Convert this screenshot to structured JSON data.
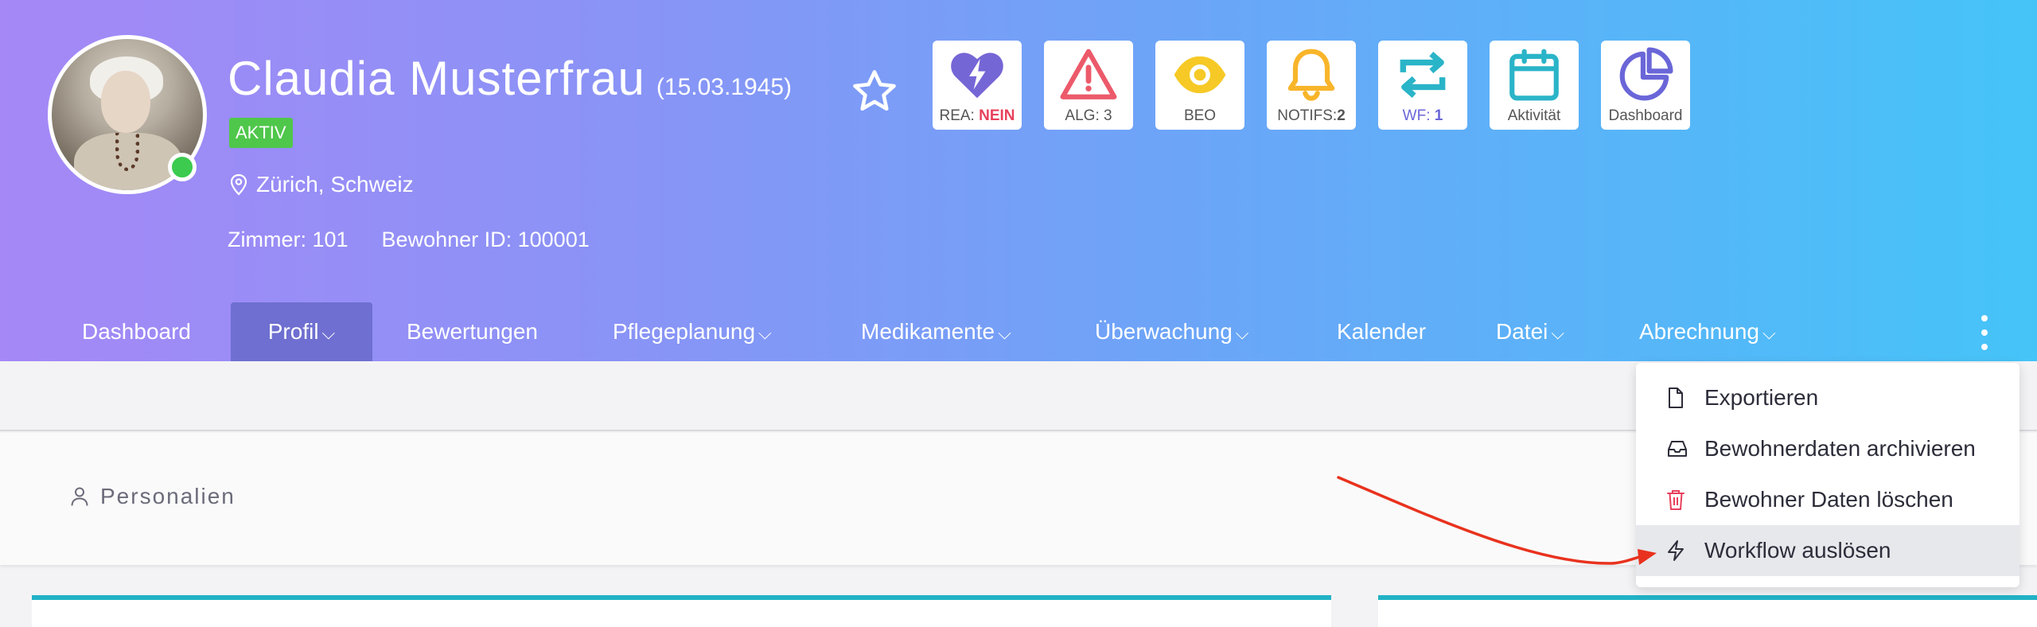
{
  "patient": {
    "name": "Claudia Musterfrau",
    "dob": "(15.03.1945)",
    "status": "AKTIV",
    "location": "Zürich, Schweiz",
    "room": "Zimmer: 101",
    "resident_id": "Bewohner ID: 100001"
  },
  "tiles": [
    {
      "icon": "heart-bolt-icon",
      "label_prefix": "REA: ",
      "label_value": "NEIN",
      "value_color": "#e8405c",
      "color": "#7566d6"
    },
    {
      "icon": "warning-triangle-icon",
      "label": "ALG: 3",
      "color": "#ec5a6a"
    },
    {
      "icon": "eye-icon",
      "label": "BEO",
      "color": "#f6c926"
    },
    {
      "icon": "bell-icon",
      "label_prefix": "NOTIFS:",
      "label_value": "2",
      "color": "#f8b52a"
    },
    {
      "icon": "repeat-icon",
      "label_prefix": "WF: ",
      "label_value": "1",
      "color": "#2ab4c8"
    },
    {
      "icon": "calendar-icon",
      "label": "Aktivität",
      "color": "#2ab4c8"
    },
    {
      "icon": "pie-chart-icon",
      "label": "Dashboard",
      "color": "#6a66d8"
    }
  ],
  "nav": [
    {
      "label": "Dashboard",
      "chevron": false
    },
    {
      "label": "Profil",
      "chevron": true,
      "active": true
    },
    {
      "label": "Bewertungen",
      "chevron": false
    },
    {
      "label": "Pflegeplanung",
      "chevron": true
    },
    {
      "label": "Medikamente",
      "chevron": true
    },
    {
      "label": "Überwachung",
      "chevron": true
    },
    {
      "label": "Kalender",
      "chevron": false
    },
    {
      "label": "Datei",
      "chevron": true
    },
    {
      "label": "Abrechnung",
      "chevron": true
    }
  ],
  "section": {
    "personalien": "Personalien"
  },
  "menu": [
    {
      "label": "Exportieren",
      "icon": "file-icon"
    },
    {
      "label": "Bewohnerdaten archivieren",
      "icon": "inbox-icon"
    },
    {
      "label": "Bewohner Daten löschen",
      "icon": "trash-icon",
      "color": "#e8405c"
    },
    {
      "label": "Workflow auslösen",
      "icon": "bolt-icon",
      "hover": true
    }
  ],
  "colors": {
    "accent": "#6e6fd0",
    "annotation_arrow": "#e8321e",
    "online": "#3ccb4f"
  }
}
